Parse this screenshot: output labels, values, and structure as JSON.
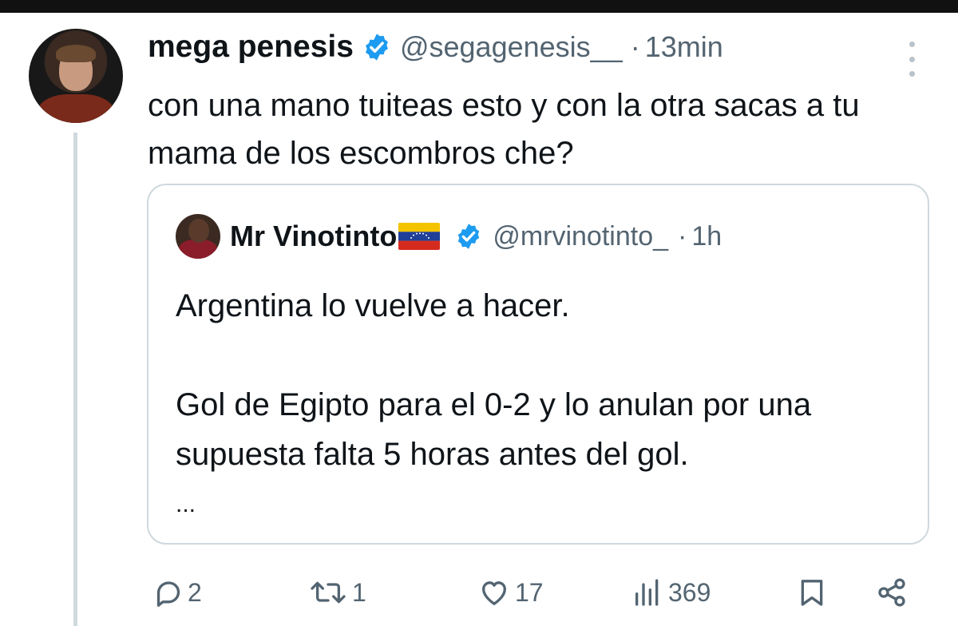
{
  "tweet": {
    "display_name": "mega penesis",
    "handle": "@segagenesis__",
    "separator": "·",
    "time": "13min",
    "text": "con una mano tuiteas esto y con la otra sacas a tu mama de los escombros che?",
    "avatar_icon": "user-avatar-icon",
    "verified_color": "#1d9bf0"
  },
  "quote": {
    "display_name": "Mr Vinotinto",
    "flag_icon": "venezuela-flag-icon",
    "handle": "@mrvinotinto_",
    "separator": "·",
    "time": "1h",
    "line1": "Argentina lo vuelve a hacer.",
    "line2": "Gol de Egipto para el 0-2 y lo anulan por una supuesta falta 5 horas antes del gol.",
    "ellipsis": "..."
  },
  "actions": {
    "replies": "2",
    "retweets": "1",
    "likes": "17",
    "views": "369",
    "bookmark_icon": "bookmark-icon",
    "share_icon": "share-icon"
  },
  "colors": {
    "text": "#0f1419",
    "muted": "#536471",
    "border": "#cfd9de",
    "verified": "#1d9bf0"
  }
}
